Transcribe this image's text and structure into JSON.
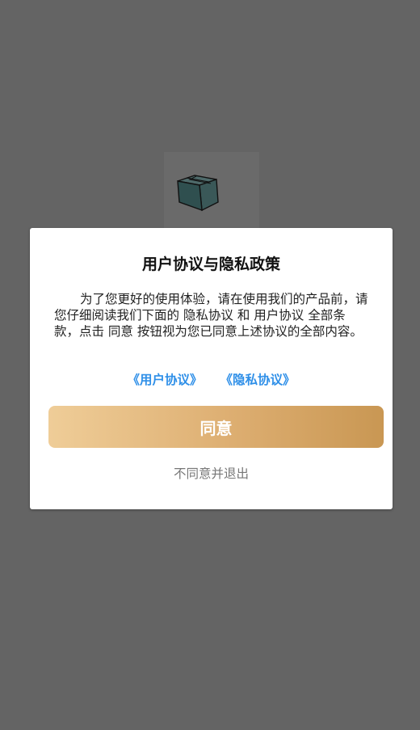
{
  "dialog": {
    "title": "用户协议与隐私政策",
    "body": "为了您更好的使用体验，请在使用我们的产品前，请您仔细阅读我们下面的 隐私协议 和 用户协议 全部条款，点击 同意 按钮视为您已同意上述协议的全部内容。",
    "user_agreement_link": "《用户协议》",
    "privacy_link": "《隐私协议》",
    "agree_label": "同意",
    "disagree_label": "不同意并退出"
  },
  "icons": {
    "app": "box-icon"
  },
  "colors": {
    "overlay": "#646464",
    "link": "#2e8fe8",
    "button_gradient_start": "#efcd98",
    "button_gradient_end": "#c99753",
    "box_icon": "#2f4f4f"
  }
}
